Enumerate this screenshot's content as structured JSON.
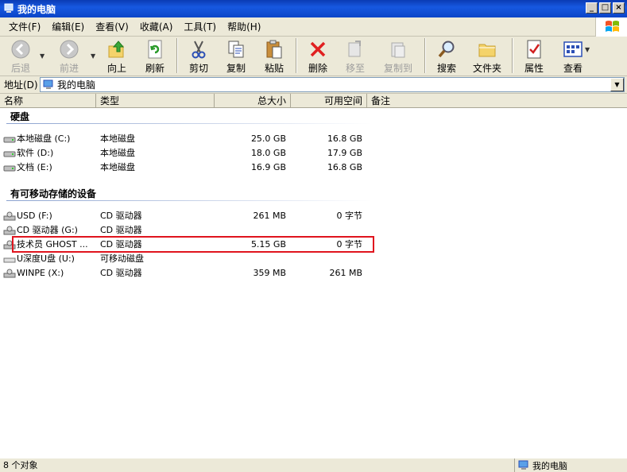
{
  "window": {
    "title": "我的电脑"
  },
  "menu": [
    "文件(F)",
    "编辑(E)",
    "查看(V)",
    "收藏(A)",
    "工具(T)",
    "帮助(H)"
  ],
  "toolbar": {
    "back": "后退",
    "forward": "前进",
    "up": "向上",
    "refresh": "刷新",
    "cut": "剪切",
    "copy": "复制",
    "paste": "粘贴",
    "delete": "删除",
    "move_to": "移至",
    "copy_to": "复制到",
    "search": "搜索",
    "folders": "文件夹",
    "properties": "属性",
    "view": "查看"
  },
  "address": {
    "label": "地址(D)",
    "value": "我的电脑"
  },
  "columns": {
    "name": "名称",
    "type": "类型",
    "total": "总大小",
    "free": "可用空间",
    "comment": "备注"
  },
  "groups": {
    "hdd": "硬盘",
    "removable": "有可移动存储的设备"
  },
  "drives": [
    {
      "name": "本地磁盘 (C:)",
      "type": "本地磁盘",
      "total": "25.0 GB",
      "free": "16.8 GB",
      "icon": "hard-disk-icon"
    },
    {
      "name": "软件 (D:)",
      "type": "本地磁盘",
      "total": "18.0 GB",
      "free": "17.9 GB",
      "icon": "hard-disk-icon"
    },
    {
      "name": "文档 (E:)",
      "type": "本地磁盘",
      "total": "16.9 GB",
      "free": "16.8 GB",
      "icon": "hard-disk-icon"
    }
  ],
  "devices": [
    {
      "name": "USD (F:)",
      "type": "CD 驱动器",
      "total": "261 MB",
      "free": "0 字节",
      "icon": "cd-drive-icon"
    },
    {
      "name": "CD 驱动器 (G:)",
      "type": "CD 驱动器",
      "total": "",
      "free": "",
      "icon": "cd-drive-icon"
    },
    {
      "name": "技术员 GHOST ...",
      "type": "CD 驱动器",
      "total": "5.15 GB",
      "free": "0 字节",
      "icon": "cd-drive-icon"
    },
    {
      "name": "U深度U盘 (U:)",
      "type": "可移动磁盘",
      "total": "",
      "free": "",
      "icon": "usb-drive-icon"
    },
    {
      "name": "WINPE (X:)",
      "type": "CD 驱动器",
      "total": "359 MB",
      "free": "261 MB",
      "icon": "cd-drive-icon"
    }
  ],
  "status": {
    "count": "8 个对象",
    "location": "我的电脑"
  },
  "colors": {
    "title_bar": "#0a3bb3",
    "highlight": "#e0141e"
  }
}
